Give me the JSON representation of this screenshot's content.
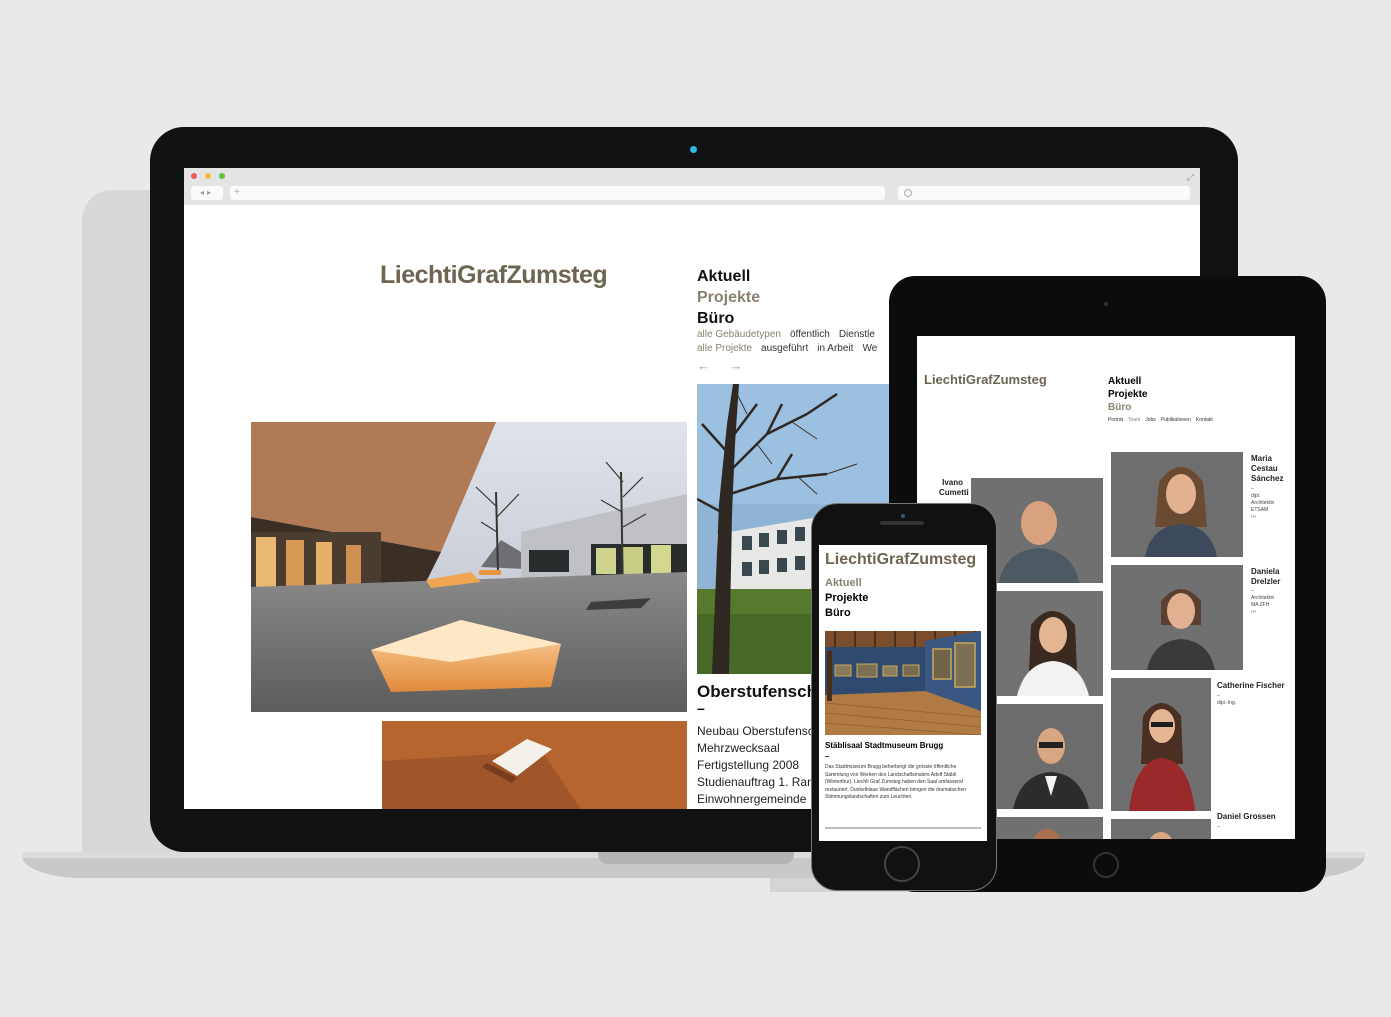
{
  "site": {
    "logo": "LiechtiGrafZumsteg"
  },
  "desktop": {
    "menu": [
      "Aktuell",
      "Projekte",
      "Büro"
    ],
    "filters_row1": [
      "alle Gebäudetypen",
      "öffentlich",
      "Dienstle"
    ],
    "filters_row2": [
      "alle Projekte",
      "ausgeführt",
      "in Arbeit",
      "We"
    ],
    "arrows": "← →",
    "project": {
      "title": "Oberstufenschu",
      "dash": "–",
      "lines": [
        "Neubau Oberstufensch",
        "Mehrzwecksaal",
        "Fertigstellung 2008",
        "Studienauftrag 1. Ran",
        "Einwohnergemeinde"
      ]
    }
  },
  "tablet": {
    "menu": [
      "Aktuell",
      "Projekte",
      "Büro"
    ],
    "submenu": [
      "Porträt",
      "Team",
      "Jobs",
      "Publikationen",
      "Kontakt"
    ],
    "people": [
      {
        "name": "Ivano\nCumetti",
        "info": ""
      },
      {
        "name": "Maria\nCestau\nSánchez",
        "info": "–\ndipl.\nArchitektin\nETSAM\n›››"
      },
      {
        "name": "Daniela\nDrelzler",
        "info": "–\nArchitektin\nMA ZFH\n›››"
      },
      {
        "name": "Catherine Fischer",
        "info": "–\ndipl.-Ing."
      },
      {
        "name": "Daniel Grossen",
        "info": "–"
      }
    ]
  },
  "phone": {
    "menu": [
      "Aktuell",
      "Projekte",
      "Büro"
    ],
    "project_title": "Stäblisaal Stadtmuseum Brugg",
    "dash": "–",
    "text": "Das Stadtmuseum Brugg beherbergt die grösste öffentliche Sammlung von Werken des Landschaftsmalers Adolf Stäbli (Winterthur). Liechti Graf Zumsteg haben den Saal umfassend restauriert. Dunkelblaue Wandflächen bringen die dramatischen Stimmungslandschaften zum Leuchten."
  },
  "colors": {
    "brand": "#6e6450",
    "muted_link": "#8a8170",
    "background": "#e9e9e9"
  }
}
